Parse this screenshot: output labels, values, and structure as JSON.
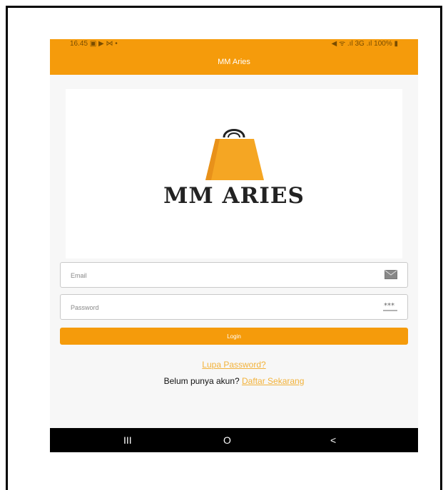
{
  "status_bar": {
    "time": "16.45",
    "left_icons": "▣ ▶ ⋈ •",
    "right_text": "◀ ᯤ .ıl 3G .ıl 100% ▮"
  },
  "app_bar": {
    "title": "MM Aries"
  },
  "logo": {
    "brand": "MM ARIES",
    "accent_color": "#f5a623"
  },
  "form": {
    "email_placeholder": "Email",
    "password_placeholder": "Password",
    "login_label": "Login"
  },
  "links": {
    "forgot_password": "Lupa Password?",
    "no_account": "Belum punya akun?",
    "register": "Daftar Sekarang"
  },
  "nav_bar": {
    "recent": "III",
    "home": "O",
    "back": "<"
  },
  "colors": {
    "primary": "#f59b0b",
    "link": "#f2b23a",
    "nav": "#000000"
  }
}
